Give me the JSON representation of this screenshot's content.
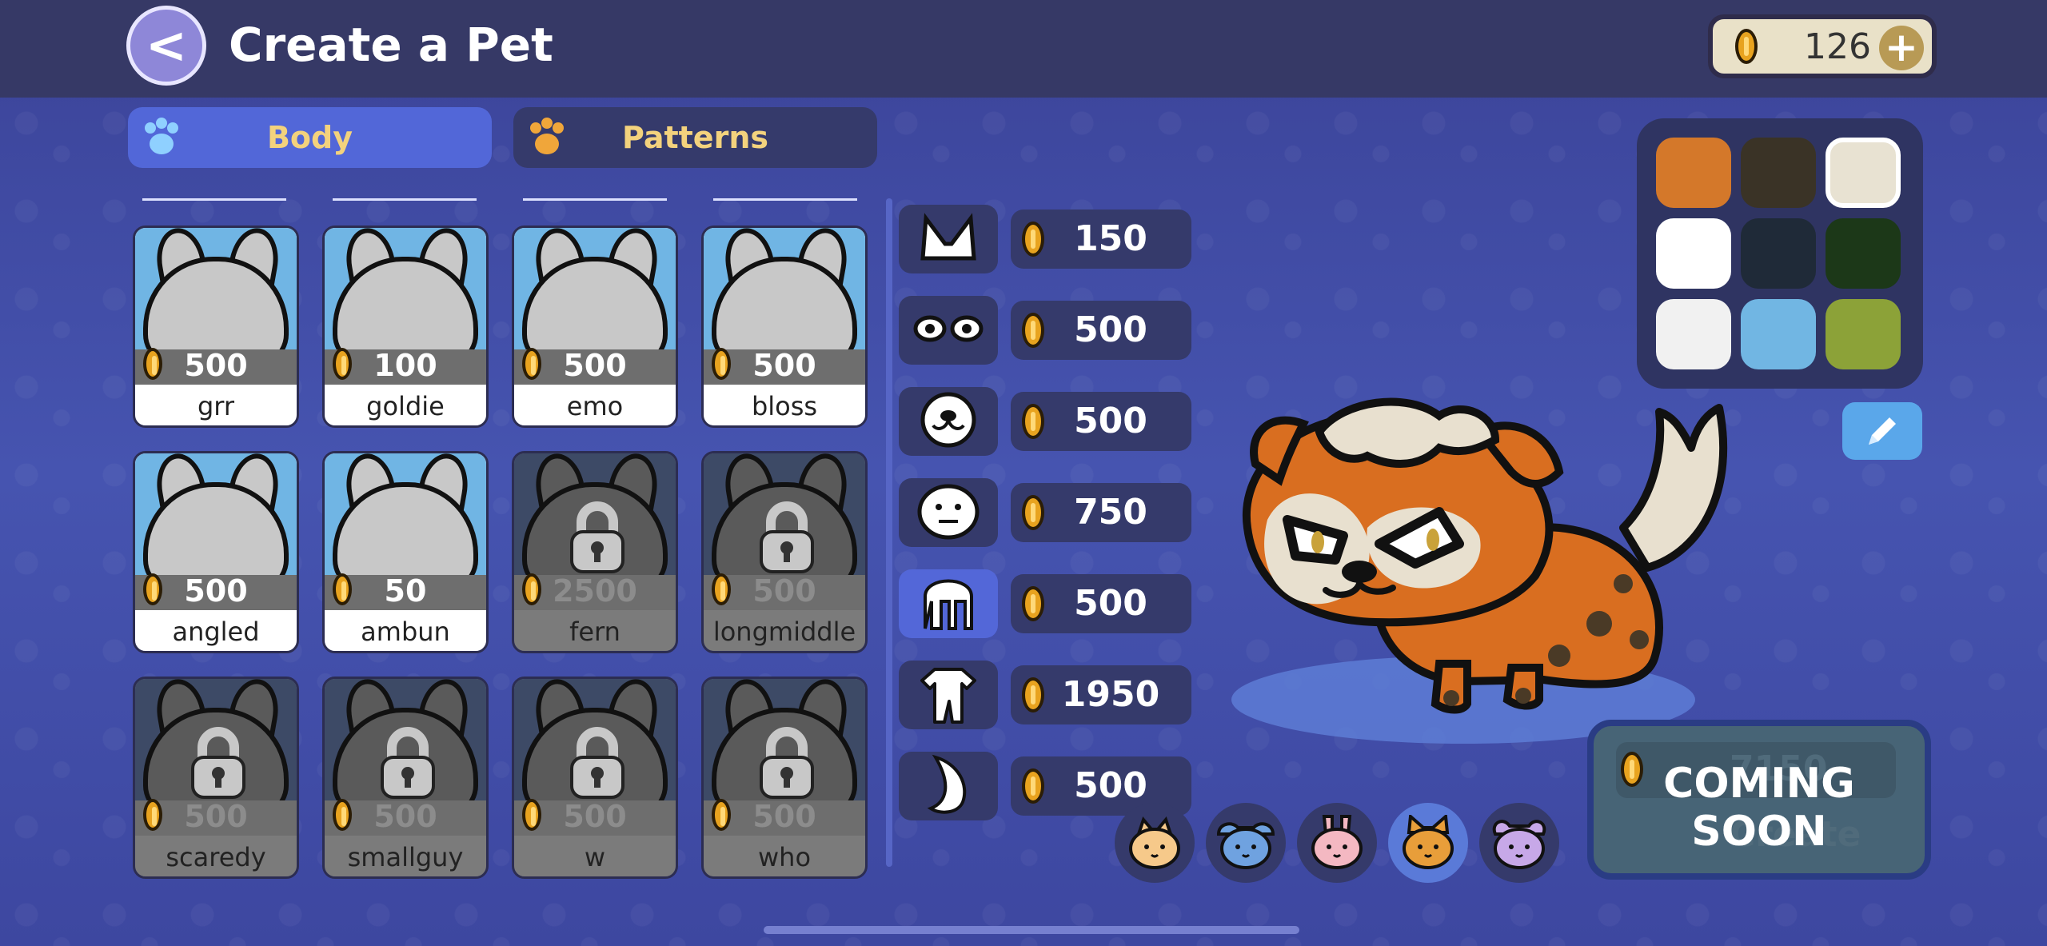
{
  "header": {
    "back_label": "<",
    "title": "Create a Pet",
    "balance": "126",
    "add_label": "+"
  },
  "tabs": [
    {
      "label": "Body",
      "active": true
    },
    {
      "label": "Patterns",
      "active": false
    }
  ],
  "items": [
    {
      "name": "grr",
      "price": "500",
      "locked": false
    },
    {
      "name": "goldie",
      "price": "100",
      "locked": false
    },
    {
      "name": "emo",
      "price": "500",
      "locked": false
    },
    {
      "name": "bloss",
      "price": "500",
      "locked": false
    },
    {
      "name": "angled",
      "price": "500",
      "locked": false
    },
    {
      "name": "ambun",
      "price": "50",
      "locked": false
    },
    {
      "name": "fern",
      "price": "2500",
      "locked": true
    },
    {
      "name": "longmiddle",
      "price": "500",
      "locked": true
    },
    {
      "name": "scaredy",
      "price": "500",
      "locked": true
    },
    {
      "name": "smallguy",
      "price": "500",
      "locked": true
    },
    {
      "name": "w",
      "price": "500",
      "locked": true
    },
    {
      "name": "who",
      "price": "500",
      "locked": true
    }
  ],
  "categories": [
    {
      "icon": "ears-icon",
      "price": "150",
      "active": false
    },
    {
      "icon": "eyes-icon",
      "price": "500",
      "active": false
    },
    {
      "icon": "snout-icon",
      "price": "500",
      "active": false
    },
    {
      "icon": "face-icon",
      "price": "750",
      "active": false
    },
    {
      "icon": "hair-icon",
      "price": "500",
      "active": true
    },
    {
      "icon": "body-icon",
      "price": "1950",
      "active": false
    },
    {
      "icon": "tail-icon",
      "price": "500",
      "active": false
    }
  ],
  "palette": {
    "colors": [
      "#d4782a",
      "#3a3326",
      "#e8e2d2",
      "#ffffff",
      "#1f2a38",
      "#1c3818",
      "#f1f1f1",
      "#71b6e3",
      "#8ca238"
    ],
    "selected_index": 2
  },
  "species": [
    {
      "icon": "cat-icon",
      "active": false
    },
    {
      "icon": "dog-icon",
      "active": false
    },
    {
      "icon": "bunny-icon",
      "active": false
    },
    {
      "icon": "fox-icon",
      "active": true
    },
    {
      "icon": "mouse-icon",
      "active": false
    }
  ],
  "create_button": {
    "cost": "7150",
    "label": "Create",
    "overlay": "COMING SOON"
  }
}
